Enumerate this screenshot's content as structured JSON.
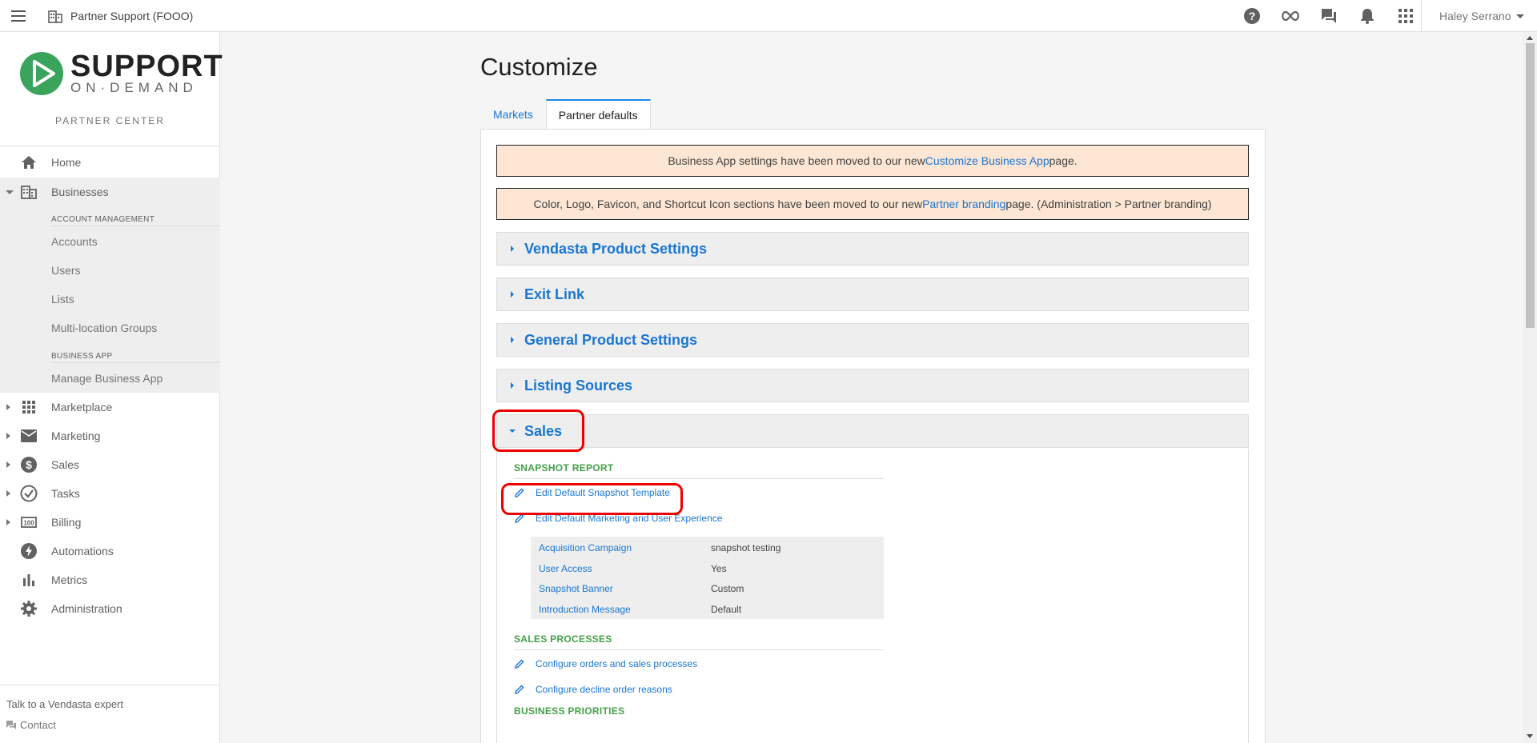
{
  "topbar": {
    "partner_name": "Partner Support (FOOO)",
    "user_name": "Haley Serrano",
    "icons": [
      "menu-icon",
      "business-icon",
      "help-icon",
      "infinity-icon",
      "chat-icon",
      "bell-icon",
      "apps-grid-icon"
    ]
  },
  "logo": {
    "word1": "SUPPORT",
    "word2": "ON·DEMAND",
    "subtitle": "PARTNER CENTER"
  },
  "sidebar": {
    "home": "Home",
    "businesses": "Businesses",
    "account_management_head": "ACCOUNT MANAGEMENT",
    "accounts": "Accounts",
    "users": "Users",
    "lists": "Lists",
    "multi_location": "Multi-location Groups",
    "business_app_head": "BUSINESS APP",
    "manage_business_app": "Manage Business App",
    "marketplace": "Marketplace",
    "marketing": "Marketing",
    "sales": "Sales",
    "tasks": "Tasks",
    "billing": "Billing",
    "automations": "Automations",
    "metrics": "Metrics",
    "administration": "Administration",
    "talk_expert": "Talk to a Vendasta expert",
    "contact": "Contact"
  },
  "main": {
    "title": "Customize",
    "tabs": [
      "Markets",
      "Partner defaults"
    ],
    "active_tab": "Partner defaults",
    "notice1": {
      "before": "Business App settings have been moved to our new ",
      "link": "Customize Business App",
      "after": " page."
    },
    "notice2": {
      "before": "Color, Logo, Favicon, and Shortcut Icon sections have been moved to our new ",
      "link": "Partner branding",
      "after": " page. (Administration > Partner branding)"
    },
    "sections": [
      "Vendasta Product Settings",
      "Exit Link",
      "General Product Settings",
      "Listing Sources",
      "Sales"
    ],
    "sales": {
      "snapshot_head": "SNAPSHOT REPORT",
      "edit_snapshot": "Edit Default Snapshot Template",
      "edit_marketing": "Edit Default Marketing and User Experience",
      "settings": [
        {
          "key": "Acquisition Campaign",
          "value": "snapshot testing"
        },
        {
          "key": "User Access",
          "value": "Yes"
        },
        {
          "key": "Snapshot Banner",
          "value": "Custom"
        },
        {
          "key": "Introduction Message",
          "value": "Default"
        }
      ],
      "sales_processes_head": "SALES PROCESSES",
      "configure_orders": "Configure orders and sales processes",
      "configure_decline": "Configure decline order reasons",
      "business_priorities_head": "BUSINESS PRIORITIES"
    }
  },
  "colors": {
    "link_blue": "#1976d2",
    "section_green": "#43a047",
    "notice_bg": "#fde6d3",
    "highlight_red": "#e00000"
  }
}
